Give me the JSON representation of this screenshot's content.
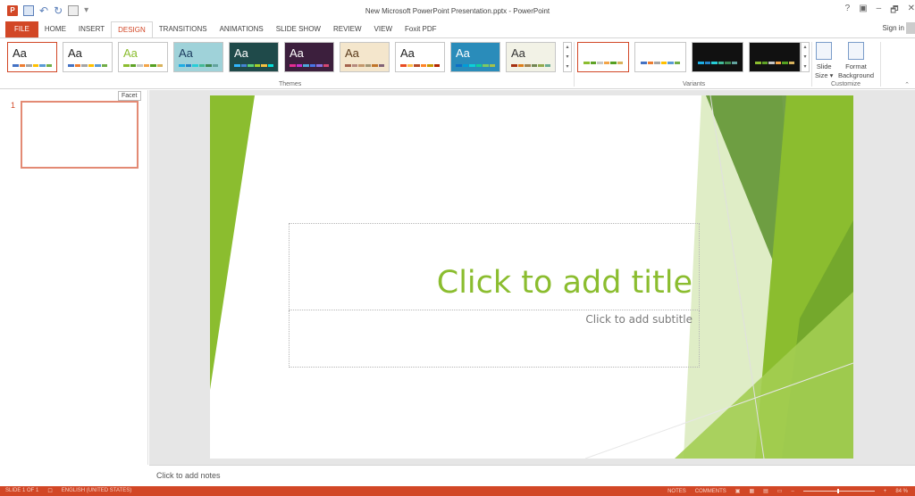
{
  "window": {
    "title": "New Microsoft PowerPoint Presentation.pptx - PowerPoint",
    "controls": [
      "?",
      "▣",
      "–",
      "🗗",
      "✕"
    ]
  },
  "tabs": [
    "FILE",
    "HOME",
    "INSERT",
    "DESIGN",
    "TRANSITIONS",
    "ANIMATIONS",
    "SLIDE SHOW",
    "REVIEW",
    "VIEW",
    "Foxit PDF"
  ],
  "active_tab": "DESIGN",
  "signin": "Sign in",
  "ribbon": {
    "themes_label": "Themes",
    "variants_label": "Variants",
    "customize_label": "Customize",
    "theme_aa": "Aa",
    "themes": [
      {
        "bg": "#ffffff",
        "text": "#222222",
        "stripes": [
          "#4472c4",
          "#ed7d31",
          "#a5a5a5",
          "#ffc000",
          "#5b9bd5",
          "#70ad47"
        ]
      },
      {
        "bg": "#ffffff",
        "text": "#222222",
        "stripes": [
          "#4472c4",
          "#ed7d31",
          "#a5a5a5",
          "#ffc000",
          "#5b9bd5",
          "#70ad47"
        ]
      },
      {
        "bg": "#ffffff",
        "text": "#8bbd2f",
        "stripes": [
          "#8bbd2f",
          "#5ea226",
          "#c6c6c6",
          "#f3a447",
          "#54a021",
          "#d8b25c"
        ]
      },
      {
        "bg": "#9fd2d9",
        "text": "#1b3b5e",
        "stripes": [
          "#1cade4",
          "#2683c6",
          "#27ced7",
          "#42ba97",
          "#3e8853",
          "#62a39f"
        ]
      },
      {
        "bg": "#1f4a4a",
        "text": "#ffffff",
        "stripes": [
          "#31b6fd",
          "#4584d3",
          "#5bd078",
          "#a5d028",
          "#f5c040",
          "#05e0db"
        ]
      },
      {
        "bg": "#3c1f3d",
        "text": "#ffffff",
        "stripes": [
          "#e32d91",
          "#c830cc",
          "#4ea6dc",
          "#4775e7",
          "#8971e1",
          "#d54773"
        ]
      },
      {
        "bg": "#f4e6cc",
        "text": "#5a3a1a",
        "stripes": [
          "#a5644e",
          "#b58b80",
          "#c3986d",
          "#a19574",
          "#c17529",
          "#826276"
        ]
      },
      {
        "bg": "#ffffff",
        "text": "#222222",
        "stripes": [
          "#e84c22",
          "#ffbd47",
          "#b64926",
          "#ff8427",
          "#cc9900",
          "#b22600"
        ]
      },
      {
        "bg": "#2a8cba",
        "text": "#ffffff",
        "stripes": [
          "#0f6fc6",
          "#009dd9",
          "#0bd0d9",
          "#10cf9b",
          "#7cca62",
          "#a5c249"
        ]
      },
      {
        "bg": "#f2f2e6",
        "text": "#333333",
        "stripes": [
          "#a53010",
          "#de7e18",
          "#9f8351",
          "#728653",
          "#92aa4c",
          "#6aac91"
        ]
      }
    ],
    "variants": [
      {
        "bg": "#ffffff",
        "stripes": [
          "#8bbd2f",
          "#5ea226",
          "#c6c6c6",
          "#f3a447",
          "#54a021",
          "#d8b25c"
        ]
      },
      {
        "bg": "#ffffff",
        "stripes": [
          "#4472c4",
          "#ed7d31",
          "#a5a5a5",
          "#ffc000",
          "#5b9bd5",
          "#70ad47"
        ]
      },
      {
        "bg": "#111111",
        "stripes": [
          "#1cade4",
          "#2683c6",
          "#27ced7",
          "#42ba97",
          "#3e8853",
          "#62a39f"
        ]
      },
      {
        "bg": "#111111",
        "stripes": [
          "#8bbd2f",
          "#5ea226",
          "#c6c6c6",
          "#f3a447",
          "#54a021",
          "#d8b25c"
        ]
      }
    ],
    "slide_size": {
      "line1": "Slide",
      "line2": "Size ▾"
    },
    "format_background": {
      "line1": "Format",
      "line2": "Background"
    }
  },
  "thumbnails": {
    "slide_number": "1",
    "tooltip": "Facet"
  },
  "slide": {
    "title_placeholder": "Click to add title",
    "subtitle_placeholder": "Click to add subtitle",
    "accent": "#8bbd2f"
  },
  "notes": {
    "placeholder": "Click to add notes"
  },
  "status": {
    "slide_info": "SLIDE 1 OF 1",
    "language": "ENGLISH (UNITED STATES)",
    "notes": "NOTES",
    "comments": "COMMENTS",
    "zoom": "84 %"
  },
  "colors": {
    "brand": "#d24726",
    "facet_green": "#8bbd2f"
  }
}
